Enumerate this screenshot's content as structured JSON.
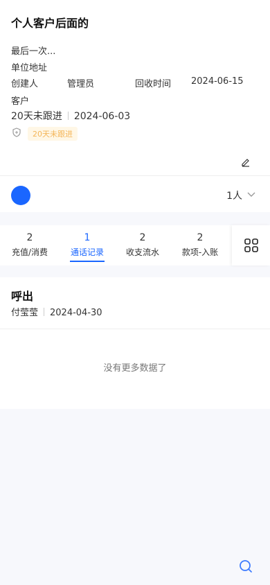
{
  "customer": {
    "name": "个人客户后面的",
    "last_line": "最后一次...",
    "address_label": "单位地址",
    "creator_label": "创建人",
    "creator_value": "管理员",
    "payback_label": "回收时间",
    "payback_value": "2024-06-15",
    "type_label": "客户",
    "follow_status": "20天未跟进",
    "follow_date": "2024-06-03",
    "tag": "20天未跟进"
  },
  "members": {
    "count": "1人"
  },
  "tabs": [
    {
      "count": "2",
      "label": "充值/消费"
    },
    {
      "count": "1",
      "label": "通话记录"
    },
    {
      "count": "2",
      "label": "收支流水"
    },
    {
      "count": "2",
      "label": "款项-入账"
    }
  ],
  "active_tab": 1,
  "record": {
    "type": "呼出",
    "person": "付莹莹",
    "date": "2024-04-30"
  },
  "no_more": "没有更多数据了",
  "colors": {
    "accent": "#1a66ff",
    "tag_bg": "#fff7e6",
    "tag_text": "#f4b65a"
  },
  "icons": [
    "shield-icon",
    "edit-icon",
    "chevron-down-icon",
    "grid-icon",
    "search-icon"
  ]
}
